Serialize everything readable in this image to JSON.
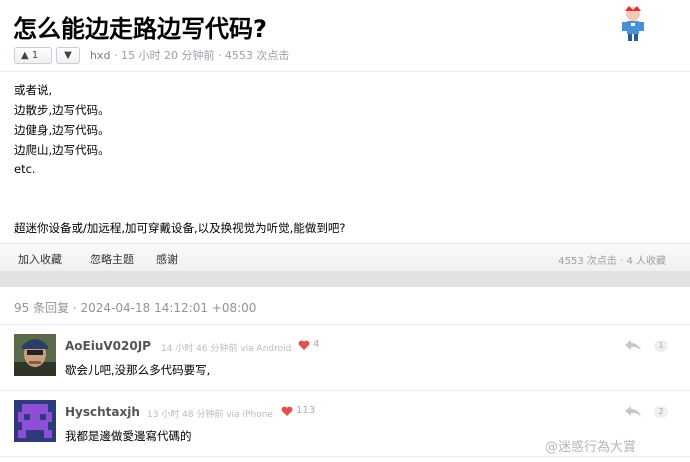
{
  "topic": {
    "title": "怎么能边走路边写代码?",
    "vote_up": "1",
    "author": "hxd",
    "meta_rest": " · 15 小时 20 分钟前 · 4553 次点击",
    "content_lines": [
      "或者说,",
      "边散步,边写代码。",
      "边健身,边写代码。",
      "边爬山,边写代码。",
      "etc.",
      "超迷你设备或/加远程,加可穿戴设备,以及换视觉为听觉,能做到吧?"
    ],
    "footer_buttons": [
      "加入收藏",
      "忽略主题",
      "感谢"
    ],
    "footer_stats": "4553 次点击 · 4 人收藏"
  },
  "replies": {
    "summary": "95 条回复 · 2024-04-18 14:12:01 +08:00",
    "items": [
      {
        "user": "AoEiuV020JP",
        "time": "14 小时 46 分钟前 via Android",
        "likes": "4",
        "text": "歇会儿吧,没那么多代码要写,",
        "floor": "1"
      },
      {
        "user": "Hyschtaxjh",
        "time": "13 小时 48 分钟前 via iPhone",
        "likes": "113",
        "text": "我都是邊做愛邊寫代碼的",
        "floor": "2"
      }
    ]
  },
  "watermark": "@迷惑行為大賞",
  "colors": {
    "heart": "#e05252",
    "accent": "#778087"
  }
}
